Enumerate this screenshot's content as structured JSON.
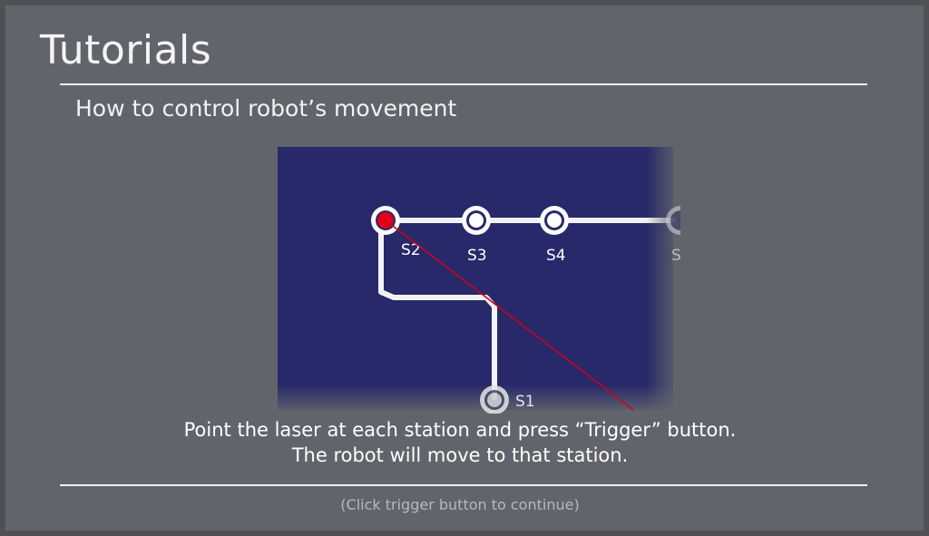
{
  "tutorial": {
    "title": "Tutorials",
    "subtitle": "How to control robot’s movement",
    "instruction_line1": "Point the laser at each station and press “Trigger” button.",
    "instruction_line2": "The robot will move to that station.",
    "continue_hint": "(Click trigger button to continue)"
  },
  "map": {
    "stations": [
      {
        "id": "S2",
        "label": "S2",
        "selected": true
      },
      {
        "id": "S3",
        "label": "S3",
        "selected": false
      },
      {
        "id": "S4",
        "label": "S4",
        "selected": false
      },
      {
        "id": "S5",
        "label": "S",
        "selected": false
      },
      {
        "id": "S1",
        "label": "S1",
        "selected": false
      }
    ]
  },
  "colors": {
    "background": "#62646b",
    "map_background": "#27296b",
    "track": "#ffffff",
    "selected_station": "#e0001b",
    "laser": "#d0001a"
  }
}
